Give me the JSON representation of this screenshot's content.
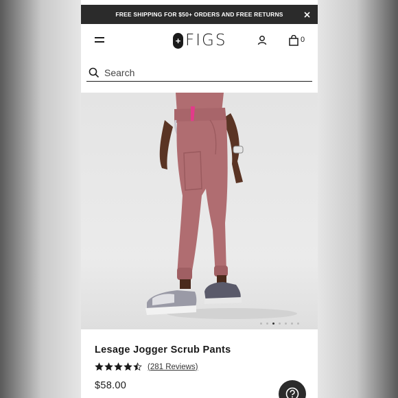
{
  "promo": {
    "text": "FREE SHIPPING FOR $50+ ORDERS AND FREE RETURNS",
    "close_icon": "close-icon"
  },
  "header": {
    "logo_text": "FIGS",
    "logo_mark": "+",
    "bag_count": "0",
    "icons": [
      "hamburger-menu-icon",
      "account-icon",
      "shopping-bag-icon"
    ]
  },
  "search": {
    "placeholder": "Search"
  },
  "carousel": {
    "slide_count": 7,
    "active_index": 2
  },
  "product": {
    "title": "Lesage Jogger Scrub Pants",
    "rating": 4.5,
    "reviews_label": "(281 Reviews)",
    "price": "$58.00"
  },
  "help": {
    "icon": "help-icon"
  },
  "colors": {
    "promo_bg": "#2b2b2b",
    "pants": "#b06d71",
    "text": "#1a1a1a"
  }
}
